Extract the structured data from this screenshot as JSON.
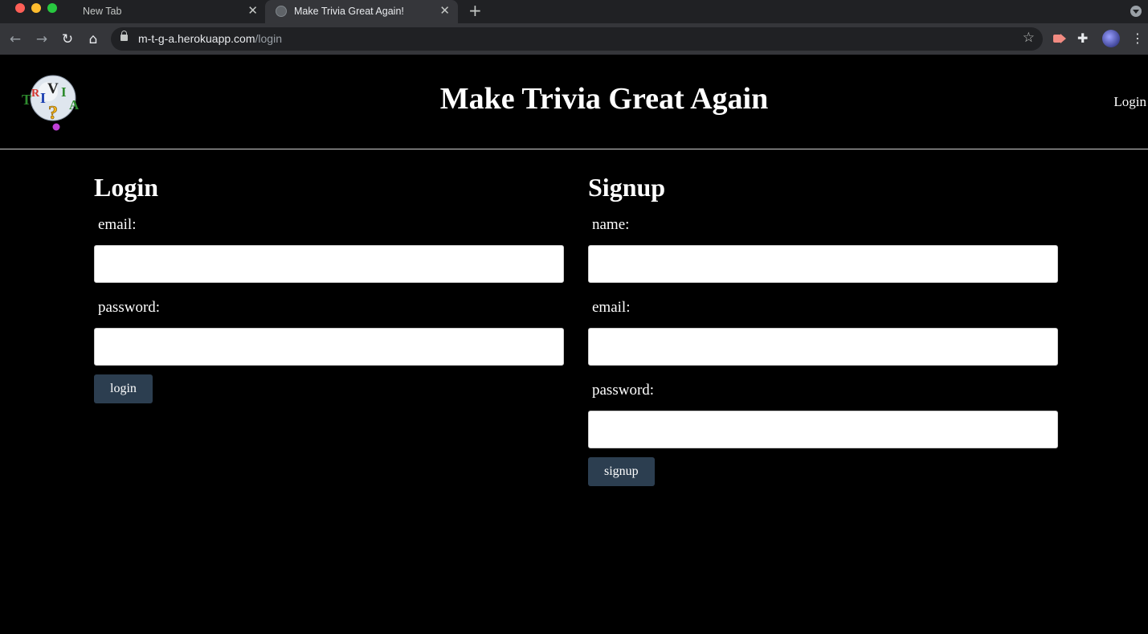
{
  "browser": {
    "tabs": [
      {
        "title": "New Tab",
        "active": false
      },
      {
        "title": "Make Trivia Great Again!",
        "active": true
      }
    ],
    "url": {
      "host": "m-t-g-a.herokuapp.com",
      "path": "/login"
    },
    "icons": {
      "back": "arrow-left-icon",
      "forward": "arrow-right-icon",
      "reload": "reload-icon",
      "home": "home-icon",
      "lock": "lock-icon",
      "star": "star-icon",
      "new_tab": "plus-icon",
      "close": "close-icon",
      "extension_video": "video-extension-icon",
      "extensions": "puzzle-icon",
      "menu": "more-vert-icon"
    }
  },
  "site": {
    "title": "Make Trivia Great Again",
    "nav": {
      "login": "Login"
    },
    "logo": {
      "letters": [
        "T",
        "R",
        "I",
        "V",
        "I",
        "A"
      ],
      "mark": "?"
    }
  },
  "login": {
    "heading": "Login",
    "email_label": "email:",
    "email_value": "",
    "password_label": "password:",
    "password_value": "",
    "submit": "login"
  },
  "signup": {
    "heading": "Signup",
    "name_label": "name:",
    "name_value": "",
    "email_label": "email:",
    "email_value": "",
    "password_label": "password:",
    "password_value": "",
    "submit": "signup"
  },
  "colors": {
    "page_bg": "#000000",
    "button_bg": "#2c3e50",
    "text": "#ffffff"
  }
}
